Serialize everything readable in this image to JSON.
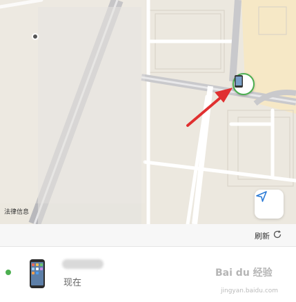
{
  "map": {
    "legal_label": "法律信息",
    "locate_icon": "location-arrow-icon",
    "pin_icon": "phone-icon",
    "annotation_color": "#e03030"
  },
  "list": {
    "refresh_label": "刷新",
    "refresh_icon": "refresh-icon",
    "devices": [
      {
        "status_text": "现在",
        "online_color": "#4caf50",
        "icon": "phone-icon"
      }
    ]
  },
  "watermark": {
    "brand": "Bai du 经验",
    "sub": "jingyan.baidu.com"
  }
}
